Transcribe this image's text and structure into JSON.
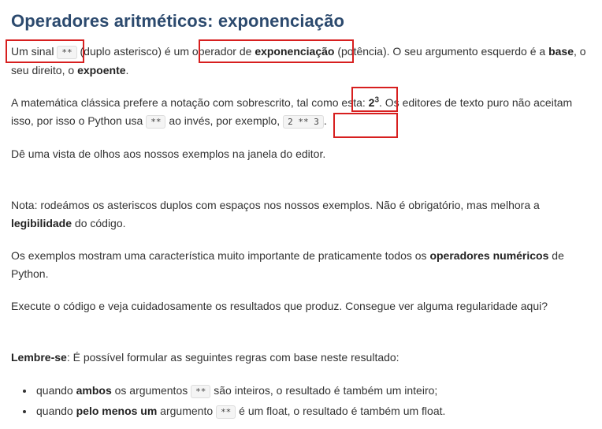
{
  "title": "Operadores aritméticos: exponenciação",
  "p1": {
    "t1": "Um sinal ",
    "code": "**",
    "t2": " (duplo asterisco) é um ",
    "t3": "operador de ",
    "b1": "exponenciação",
    "t4": " (potência). O seu argumento esquerdo é a ",
    "b2": "base",
    "t5": ", o seu direito, o ",
    "b3": "expoente",
    "t6": "."
  },
  "p2": {
    "t1": "A matemática clássica prefere a notação com sobrescrito, tal como esta: ",
    "base": "2",
    "exp": "3",
    "t2": ". Os editores de texto puro não aceitam isso, por isso o Python usa ",
    "code1": "**",
    "t3": " ao invés, por exemplo, ",
    "code2": "2 ** 3",
    "t4": "."
  },
  "p3": "Dê uma vista de olhos aos nossos exemplos na janela do editor.",
  "p4": {
    "t1": "Nota: rodeámos os asteriscos duplos com espaços nos nossos exemplos. Não é obrigatório, mas melhora a ",
    "b1": "legibilidade",
    "t2": " do código."
  },
  "p5": {
    "t1": "Os exemplos mostram uma característica muito importante de praticamente todos os ",
    "b1": "operadores numéricos",
    "t2": " de Python."
  },
  "p6": "Execute o código e veja cuidadosamente os resultados que produz. Consegue ver alguma regularidade aqui?",
  "p7": {
    "b1": "Lembre-se",
    "t1": ": É possível formular as seguintes regras com base neste resultado:"
  },
  "list": [
    {
      "t1": "quando ",
      "b1": "ambos",
      "t2": " os argumentos ",
      "code": "**",
      "t3": " são inteiros, o resultado é também um inteiro;"
    },
    {
      "t1": "quando ",
      "b1": "pelo menos um",
      "t2": " argumento ",
      "code": "**",
      "t3": " é um float, o resultado é também um float."
    }
  ],
  "highlight_color": "#d71f1f",
  "title_color": "#2c4a6e"
}
